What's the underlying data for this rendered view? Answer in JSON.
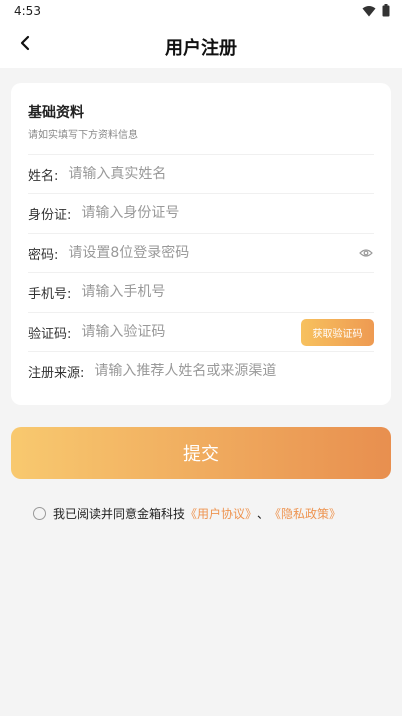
{
  "status_bar": {
    "time": "4:53",
    "icons": [
      "wifi-icon",
      "battery-icon"
    ]
  },
  "header": {
    "title": "用户注册",
    "back_icon": "chevron-left-icon"
  },
  "form": {
    "section_title": "基础资料",
    "section_subtitle": "请如实填写下方资料信息",
    "fields": [
      {
        "label": "姓名:",
        "placeholder": "请输入真实姓名"
      },
      {
        "label": "身份证:",
        "placeholder": "请输入身份证号"
      },
      {
        "label": "密码:",
        "placeholder": "请设置8位登录密码",
        "icon": "eye-icon"
      },
      {
        "label": "手机号:",
        "placeholder": "请输入手机号"
      },
      {
        "label": "验证码:",
        "placeholder": "请输入验证码",
        "button": "获取验证码"
      },
      {
        "label": "注册来源:",
        "placeholder": "请输入推荐人姓名或来源渠道"
      }
    ]
  },
  "submit_label": "提交",
  "agreement": {
    "checked": false,
    "text": "我已阅读并同意金箱科技",
    "link1": "《用户协议》",
    "separator": "、",
    "link2": "《隐私政策》"
  },
  "colors": {
    "accent": "#ee9450",
    "gradient_start": "#f8c96f",
    "gradient_end": "#e88f4f",
    "background": "#f4f4f4"
  }
}
